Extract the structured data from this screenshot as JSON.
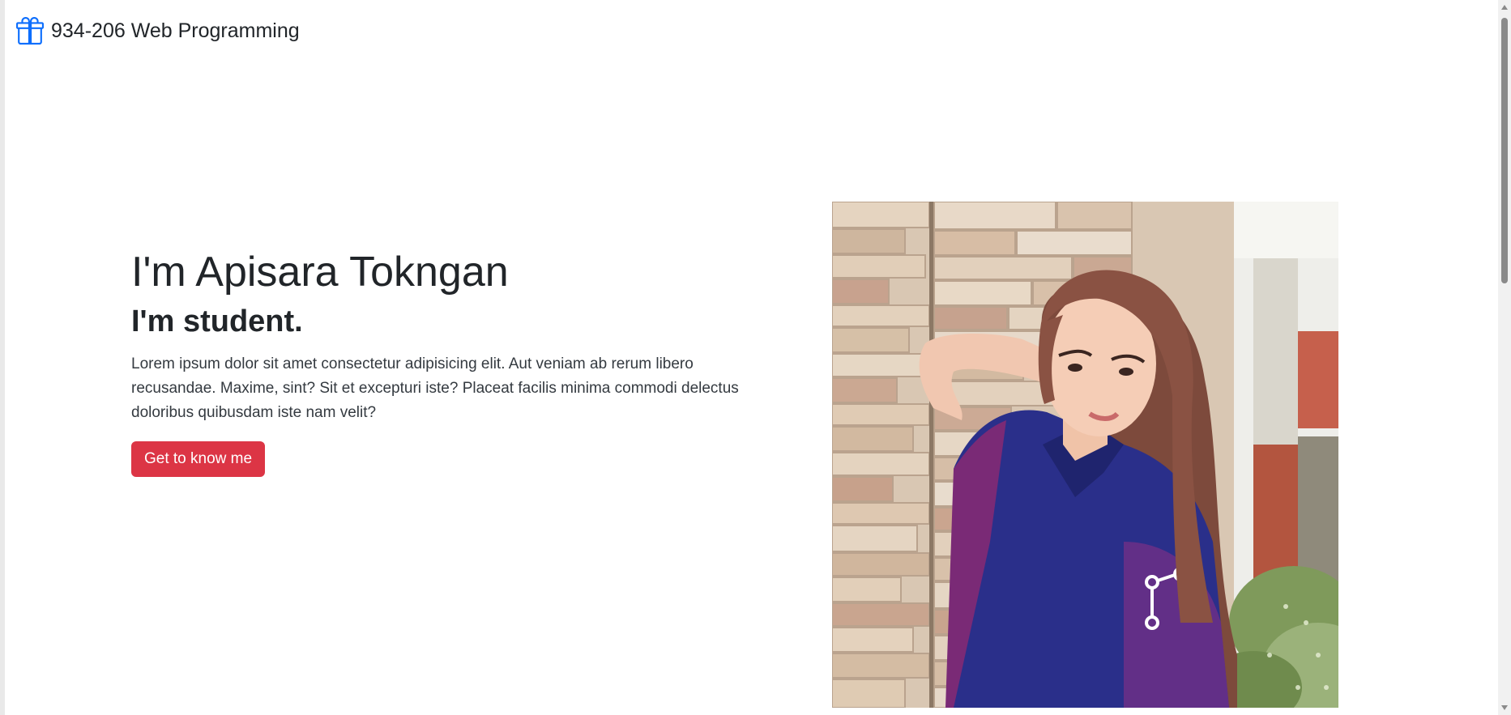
{
  "navbar": {
    "brand_icon": "gift-icon",
    "brand_text": "934-206 Web Programming",
    "accent_color": "#0d6efd"
  },
  "hero": {
    "title": "I'm Apisara Tokngan",
    "subtitle": "I'm student.",
    "description": "Lorem ipsum dolor sit amet consectetur adipisicing elit. Aut veniam ab rerum libero recusandae. Maxime, sint? Sit et excepturi iste? Placeat facilis minima commodi delectus doloribus quibusdam iste nam velit?",
    "button_label": "Get to know me",
    "button_color": "#dc3545"
  },
  "portrait": {
    "alt": "Apisara Tokngan"
  }
}
